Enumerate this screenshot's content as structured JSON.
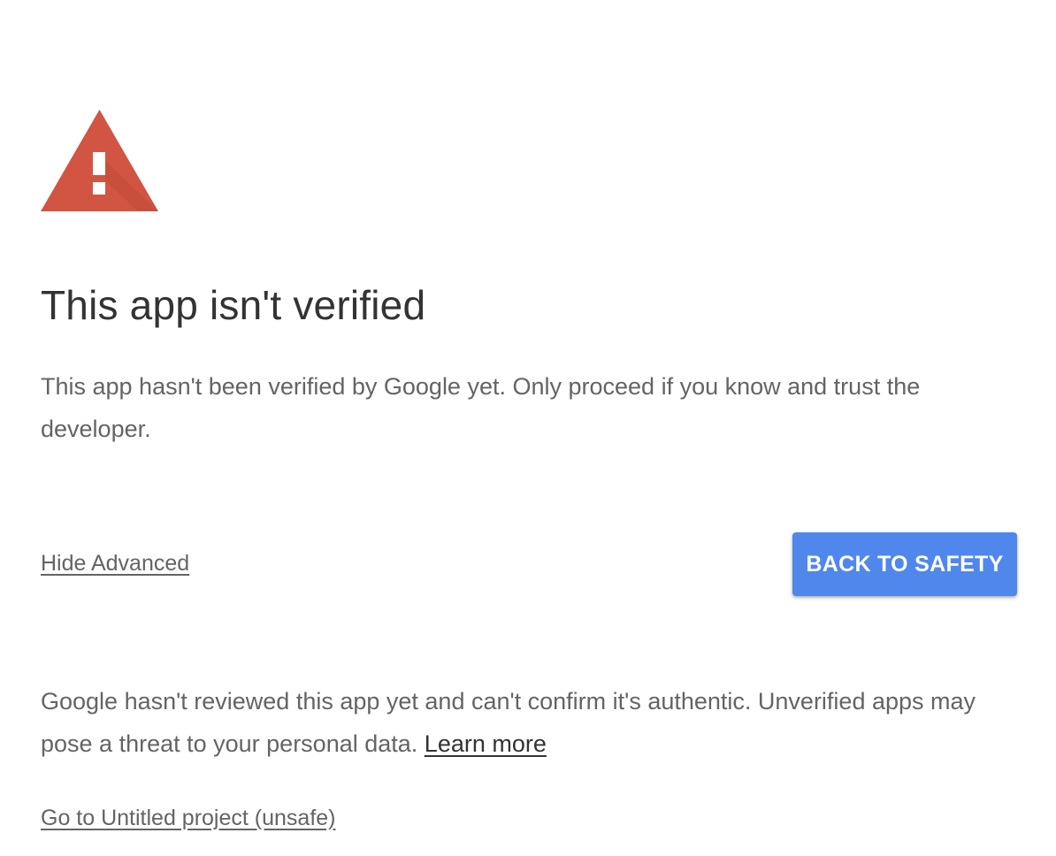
{
  "warning": {
    "icon": "warning-triangle-icon",
    "icon_color": "#d25442",
    "title": "This app isn't verified",
    "lead": "This app hasn't been verified by Google yet. Only proceed if you know and trust the developer."
  },
  "actions": {
    "hide_advanced_label": "Hide Advanced",
    "back_to_safety_label": "BACK TO SAFETY",
    "button_color": "#5087ec"
  },
  "advanced": {
    "details_text": "Google hasn't reviewed this app yet and can't confirm it's authentic. Unverified apps may pose a threat to your personal data.",
    "learn_more_label": "Learn more",
    "proceed_label": "Go to Untitled project (unsafe)"
  }
}
